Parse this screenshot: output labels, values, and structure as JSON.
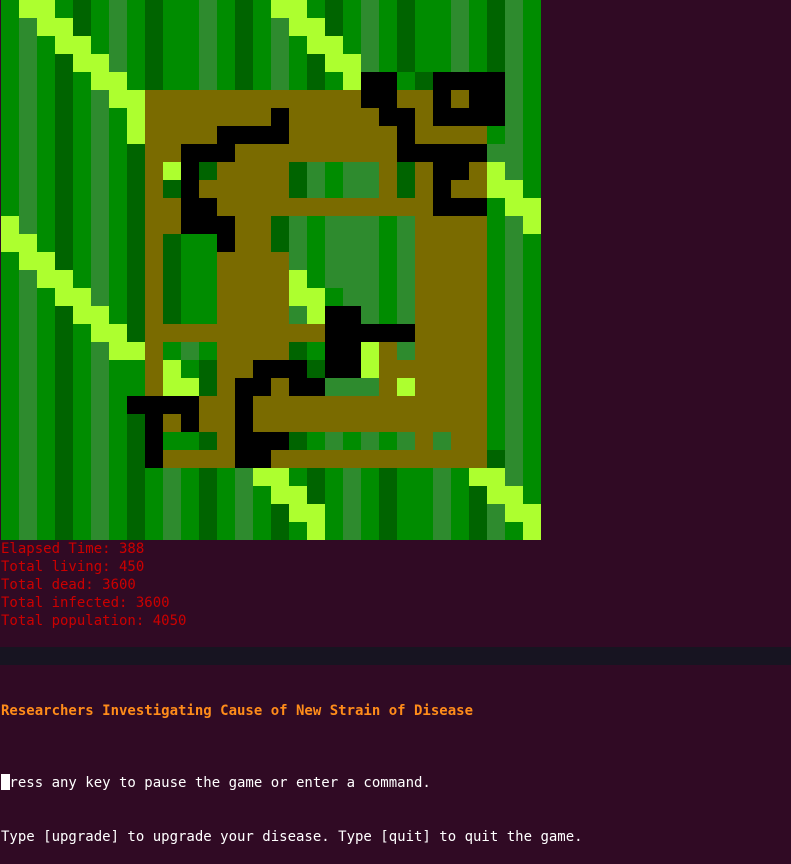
{
  "colors": {
    "G": "#008c00",
    "D": "#006400",
    "M": "#2e8b2e",
    "L": "#39a839",
    "Y": "#adff2f",
    "O": "#7a6b00",
    "K": "#000000"
  },
  "map_rows": [
    "GYYGDGMGDGGMGDGYYGDGMGDGGMGDMG",
    "GMYYDGMGDGGMGDGMYYDGMGDGGMGDMG",
    "GMGYYGMGDGGMGDGMGYYGMGDGGMGDMG",
    "GMGDYYMGDGGMGDGMGDYYMGDGGMGDMG",
    "GMGDGYYGDGGMGDGMGDGYKKGDKKKKMG",
    "GMGDGMYYOOOOOOOOOOOOKKOOKOKKMG",
    "GMGDGMGYOOOOOOOKOOOOOKKOKKKKMG",
    "GMGDGMGYOOOOKKKKOOOOOOKOOOOGMG",
    "GMGDGMGDOOKKKOOOOOOOOOKKKKKMMG",
    "GMGDGMGDOYKDOOOODMGMMODOKKOYMG",
    "GMGDGMGDODKOOOOODMGMMODOKOOYYG",
    "GMGDGMGDOOKKOOOOOOOOOOOOKKKGYY",
    "YMGDGMGDOOKKKOODMGMMMGMOOOOGMY",
    "YYGDGMGDODGGKOODMGMMMGMOOOOGMG",
    "GYYDGMGDODGGOOOOMGMMMGMOOOOGMG",
    "GMYYGMGDODGGOOOOYGMMMGMOOOOGMG",
    "GMGYYMGDODGGOOOOYYGMMGMOOOOGMG",
    "GMGDYYGDODGGOOOOMYKKMGMOOOOGMG",
    "GMGDGYYDOOOOOOOOOOKKKKKOOOOGMG",
    "GMGDGMYYOGMGOOOODGKKYOMOOOOGMG",
    "GMGDGMGGOYGDOOKKKDKKYOOOOOOGMG",
    "GMGDGMGGOYYDOKKOKKMMMOYOOOOGMG",
    "GMGDGMGKKKKOOKOOOOOOOOOOOOOGMG",
    "GMGDGMGDKOKOOKOOOOOOOOOOOOOGMG",
    "GMGDGMGDKGGDOKKKDGMGMGMOMOOGMG",
    "GMGDGMGDKOOOOKKOOOOOOOOOOOODMG",
    "GMGDGMGDGMGDGMYYGDGMGDGGMGYYMG",
    "GMGDGMGDGMGDGMGYYDGMGDGGMGDYYG",
    "GMGDGMGDGMGDGMGDYYGMGDGGMGDMYY",
    "GMGDGMGDGMGDGMGDGYGMGDGGMGDMGY"
  ],
  "stats": {
    "elapsed": "Elapsed Time: 388",
    "living": "Total living: 450",
    "dead": "Total dead: 3600",
    "infected": "Total infected: 3600",
    "population": "Total population: 4050"
  },
  "headline": "Researchers Investigating Cause of New Strain of Disease",
  "prompt": {
    "line1": "Press any key to pause the game or enter a command.",
    "line2": "Type [upgrade] to upgrade your disease. Type [quit] to quit the game."
  }
}
